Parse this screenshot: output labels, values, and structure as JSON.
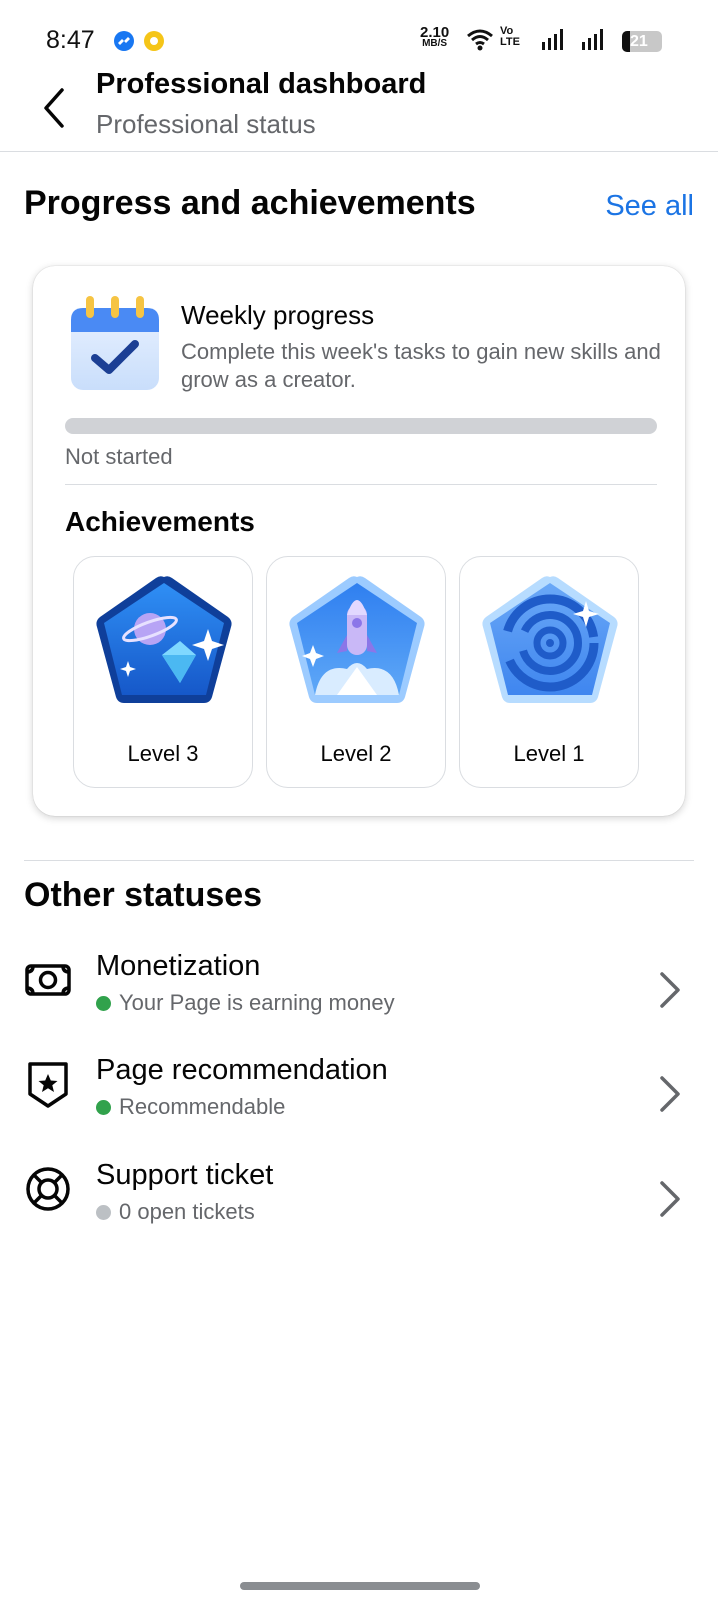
{
  "status_bar": {
    "time": "8:47",
    "net_speed_value": "2.10",
    "net_speed_unit": "MB/S",
    "volte_top": "Vo",
    "volte_bottom": "LTE",
    "battery": "21",
    "battery_fraction": 0.21,
    "icons": [
      "messenger-icon",
      "coin-icon",
      "wifi-icon",
      "signal-icon",
      "signal-icon",
      "battery-icon"
    ]
  },
  "header": {
    "title": "Professional dashboard",
    "subtitle": "Professional status",
    "back_icon": "back-arrow-icon"
  },
  "progress_section": {
    "title": "Progress and achievements",
    "see_all": "See all"
  },
  "weekly": {
    "title": "Weekly progress",
    "description": "Complete this week's tasks to gain new skills and grow as a creator.",
    "status": "Not started",
    "progress": 0,
    "icon": "calendar-check-icon"
  },
  "achievements": {
    "title": "Achievements",
    "badges": [
      {
        "label": "Level 3",
        "icon": "planet-diamond-badge-icon"
      },
      {
        "label": "Level 2",
        "icon": "rocket-badge-icon"
      },
      {
        "label": "Level 1",
        "icon": "galaxy-badge-icon"
      }
    ]
  },
  "other": {
    "title": "Other statuses",
    "items": [
      {
        "title": "Monetization",
        "subtitle": "Your Page is earning money",
        "dot_color": "#31a24c",
        "icon": "money-icon"
      },
      {
        "title": "Page recommendation",
        "subtitle": "Recommendable",
        "dot_color": "#31a24c",
        "icon": "shield-star-icon"
      },
      {
        "title": "Support ticket",
        "subtitle": "0 open tickets",
        "dot_color": "#bcc0c4",
        "icon": "lifebuoy-icon"
      }
    ]
  },
  "colors": {
    "accent": "#1b74e4",
    "status_green": "#31a24c",
    "status_gray": "#bcc0c4"
  }
}
